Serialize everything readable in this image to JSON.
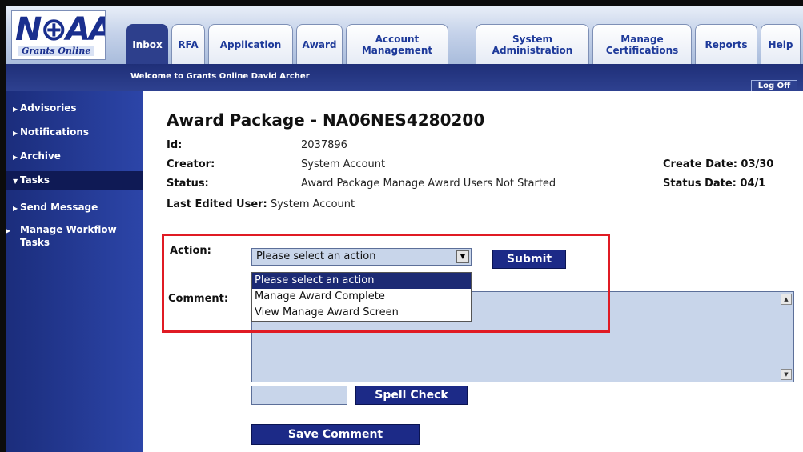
{
  "brand": {
    "logo_mark": "N⊕AA",
    "logo_sub": "Grants Online"
  },
  "tabs": [
    {
      "label": "Inbox",
      "active": true
    },
    {
      "label": "RFA"
    },
    {
      "label": "Application"
    },
    {
      "label": "Award"
    },
    {
      "label": "Account Management"
    },
    {
      "label": "System Administration"
    },
    {
      "label": "Manage Certifications"
    },
    {
      "label": "Reports"
    },
    {
      "label": "Help"
    }
  ],
  "header": {
    "welcome": "Welcome to Grants Online David Archer",
    "logoff": "Log Off"
  },
  "sidebar": {
    "items": [
      {
        "label": "Advisories"
      },
      {
        "label": "Notifications"
      },
      {
        "label": "Archive"
      },
      {
        "label": "Tasks",
        "active": true
      },
      {
        "label": "Send Message"
      },
      {
        "label": "Manage Workflow Tasks"
      }
    ]
  },
  "page": {
    "title": "Award Package - NA06NES4280200",
    "id_label": "Id:",
    "id_value": "2037896",
    "creator_label": "Creator:",
    "creator_value": "System Account",
    "status_label": "Status:",
    "status_value": "Award Package Manage Award Users  Not Started",
    "last_edited_label": "Last Edited User:",
    "last_edited_value": "System Account",
    "create_date_label": "Create Date: 03/30",
    "status_date_label": "Status Date: 04/1"
  },
  "action": {
    "label": "Action:",
    "selected": "Please select an action",
    "options": [
      "Please select an action",
      "Manage Award Complete",
      "View Manage Award Screen"
    ],
    "submit": "Submit"
  },
  "comment": {
    "label": "Comment:",
    "spell_check": "Spell Check",
    "save": "Save Comment"
  },
  "colors": {
    "accent": "#1c2a87",
    "highlight": "#e01b24",
    "field": "#c8d5ea"
  }
}
